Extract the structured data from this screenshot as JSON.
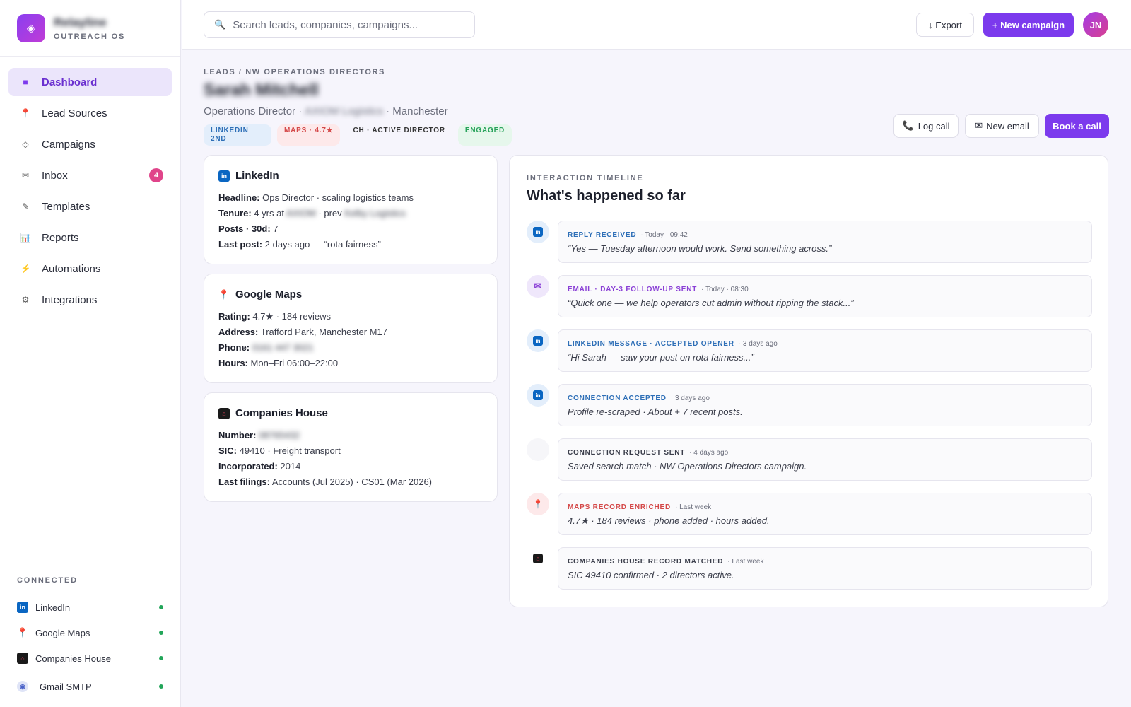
{
  "brand": {
    "name": "Relayline",
    "subtitle": "OUTREACH OS"
  },
  "nav": [
    {
      "label": "Dashboard",
      "icon": "dashboard-icon",
      "active": true
    },
    {
      "label": "Lead Sources",
      "icon": "pin-icon"
    },
    {
      "label": "Campaigns",
      "icon": "diamond-icon"
    },
    {
      "label": "Inbox",
      "icon": "mail-icon",
      "badge": "4"
    },
    {
      "label": "Templates",
      "icon": "pen-icon"
    },
    {
      "label": "Reports",
      "icon": "bar-chart-icon"
    },
    {
      "label": "Automations",
      "icon": "lightning-icon"
    },
    {
      "label": "Integrations",
      "icon": "gear-icon"
    }
  ],
  "connected": {
    "title": "CONNECTED",
    "items": [
      {
        "label": "LinkedIn"
      },
      {
        "label": "Google Maps"
      },
      {
        "label": "Companies House"
      },
      {
        "label": "Gmail SMTP"
      }
    ]
  },
  "search": {
    "placeholder": "Search leads, companies, campaigns..."
  },
  "toolbar": {
    "export_label": "↓ Export",
    "new_campaign_label": "+ New campaign",
    "avatar_initials": "JN"
  },
  "lead": {
    "breadcrumb": "LEADS / NW OPERATIONS DIRECTORS",
    "name": "Sarah Mitchell",
    "role": "Operations Director ·",
    "company": "AXIOM Logistics",
    "location": "· Manchester",
    "tags": {
      "linkedin": "LINKEDIN 2ND",
      "maps": "MAPS · 4.7★",
      "ch": "CH · ACTIVE DIRECTOR",
      "status": "ENGAGED"
    },
    "actions": {
      "log_call": "Log call",
      "new_email": "New email",
      "book_call": "Book a call"
    }
  },
  "cards": {
    "linkedin": {
      "title": "LinkedIn",
      "headline_label": "Headline:",
      "headline": "Ops Director · scaling logistics teams",
      "tenure_label": "Tenure:",
      "tenure_pre": "4 yrs at",
      "tenure_company": "AXIOM",
      "tenure_mid": "· prev",
      "tenure_prev": "Kelby Logistics",
      "posts_label": "Posts · 30d:",
      "posts": "7",
      "lastpost_label": "Last post:",
      "lastpost": "2 days ago — “rota fairness”"
    },
    "maps": {
      "title": "Google Maps",
      "rating_label": "Rating:",
      "rating": "4.7★ · 184 reviews",
      "address_label": "Address:",
      "address": "Trafford Park, Manchester M17",
      "phone_label": "Phone:",
      "phone": "0161 447 3021",
      "hours_label": "Hours:",
      "hours": "Mon–Fri 06:00–22:00"
    },
    "ch": {
      "title": "Companies House",
      "number_label": "Number:",
      "number": "08765432",
      "sic_label": "SIC:",
      "sic": "49410 · Freight transport",
      "inc_label": "Incorporated:",
      "inc": "2014",
      "filings_label": "Last filings:",
      "filings": "Accounts (Jul 2025) · CS01 (Mar 2026)"
    }
  },
  "timeline": {
    "label": "INTERACTION TIMELINE",
    "title": "What's happened so far",
    "events": [
      {
        "type": "REPLY RECEIVED",
        "time": "· Today · 09:42",
        "text": "“Yes — Tuesday afternoon would work. Send something across.”",
        "color": "#2e6fb7",
        "icon": "linkedin-icon"
      },
      {
        "type": "EMAIL · DAY-3 FOLLOW-UP SENT",
        "time": "· Today · 08:30",
        "text": "“Quick one — we help operators cut admin without ripping the stack...”",
        "color": "#8a3fd6",
        "icon": "mail-icon"
      },
      {
        "type": "LINKEDIN MESSAGE · ACCEPTED OPENER",
        "time": "· 3 days ago",
        "text": "“Hi Sarah — saw your post on rota fairness...”",
        "color": "#2e6fb7",
        "icon": "linkedin-icon"
      },
      {
        "type": "CONNECTION ACCEPTED",
        "time": "· 3 days ago",
        "text": "Profile re-scraped · About + 7 recent posts.",
        "color": "#2e6fb7",
        "icon": "linkedin-icon"
      },
      {
        "type": "CONNECTION REQUEST SENT",
        "time": "· 4 days ago",
        "text": "Saved search match · NW Operations Directors campaign.",
        "color": "#3a3d4a",
        "icon": "blank-icon"
      },
      {
        "type": "MAPS RECORD ENRICHED",
        "time": "· Last week",
        "text": "4.7★ · 184 reviews · phone added · hours added.",
        "color": "#d44848",
        "icon": "map-pin-icon"
      },
      {
        "type": "COMPANIES HOUSE RECORD MATCHED",
        "time": "· Last week",
        "text": "SIC 49410 confirmed · 2 directors active.",
        "color": "#3a3d4a",
        "icon": "companies-house-icon"
      }
    ]
  }
}
